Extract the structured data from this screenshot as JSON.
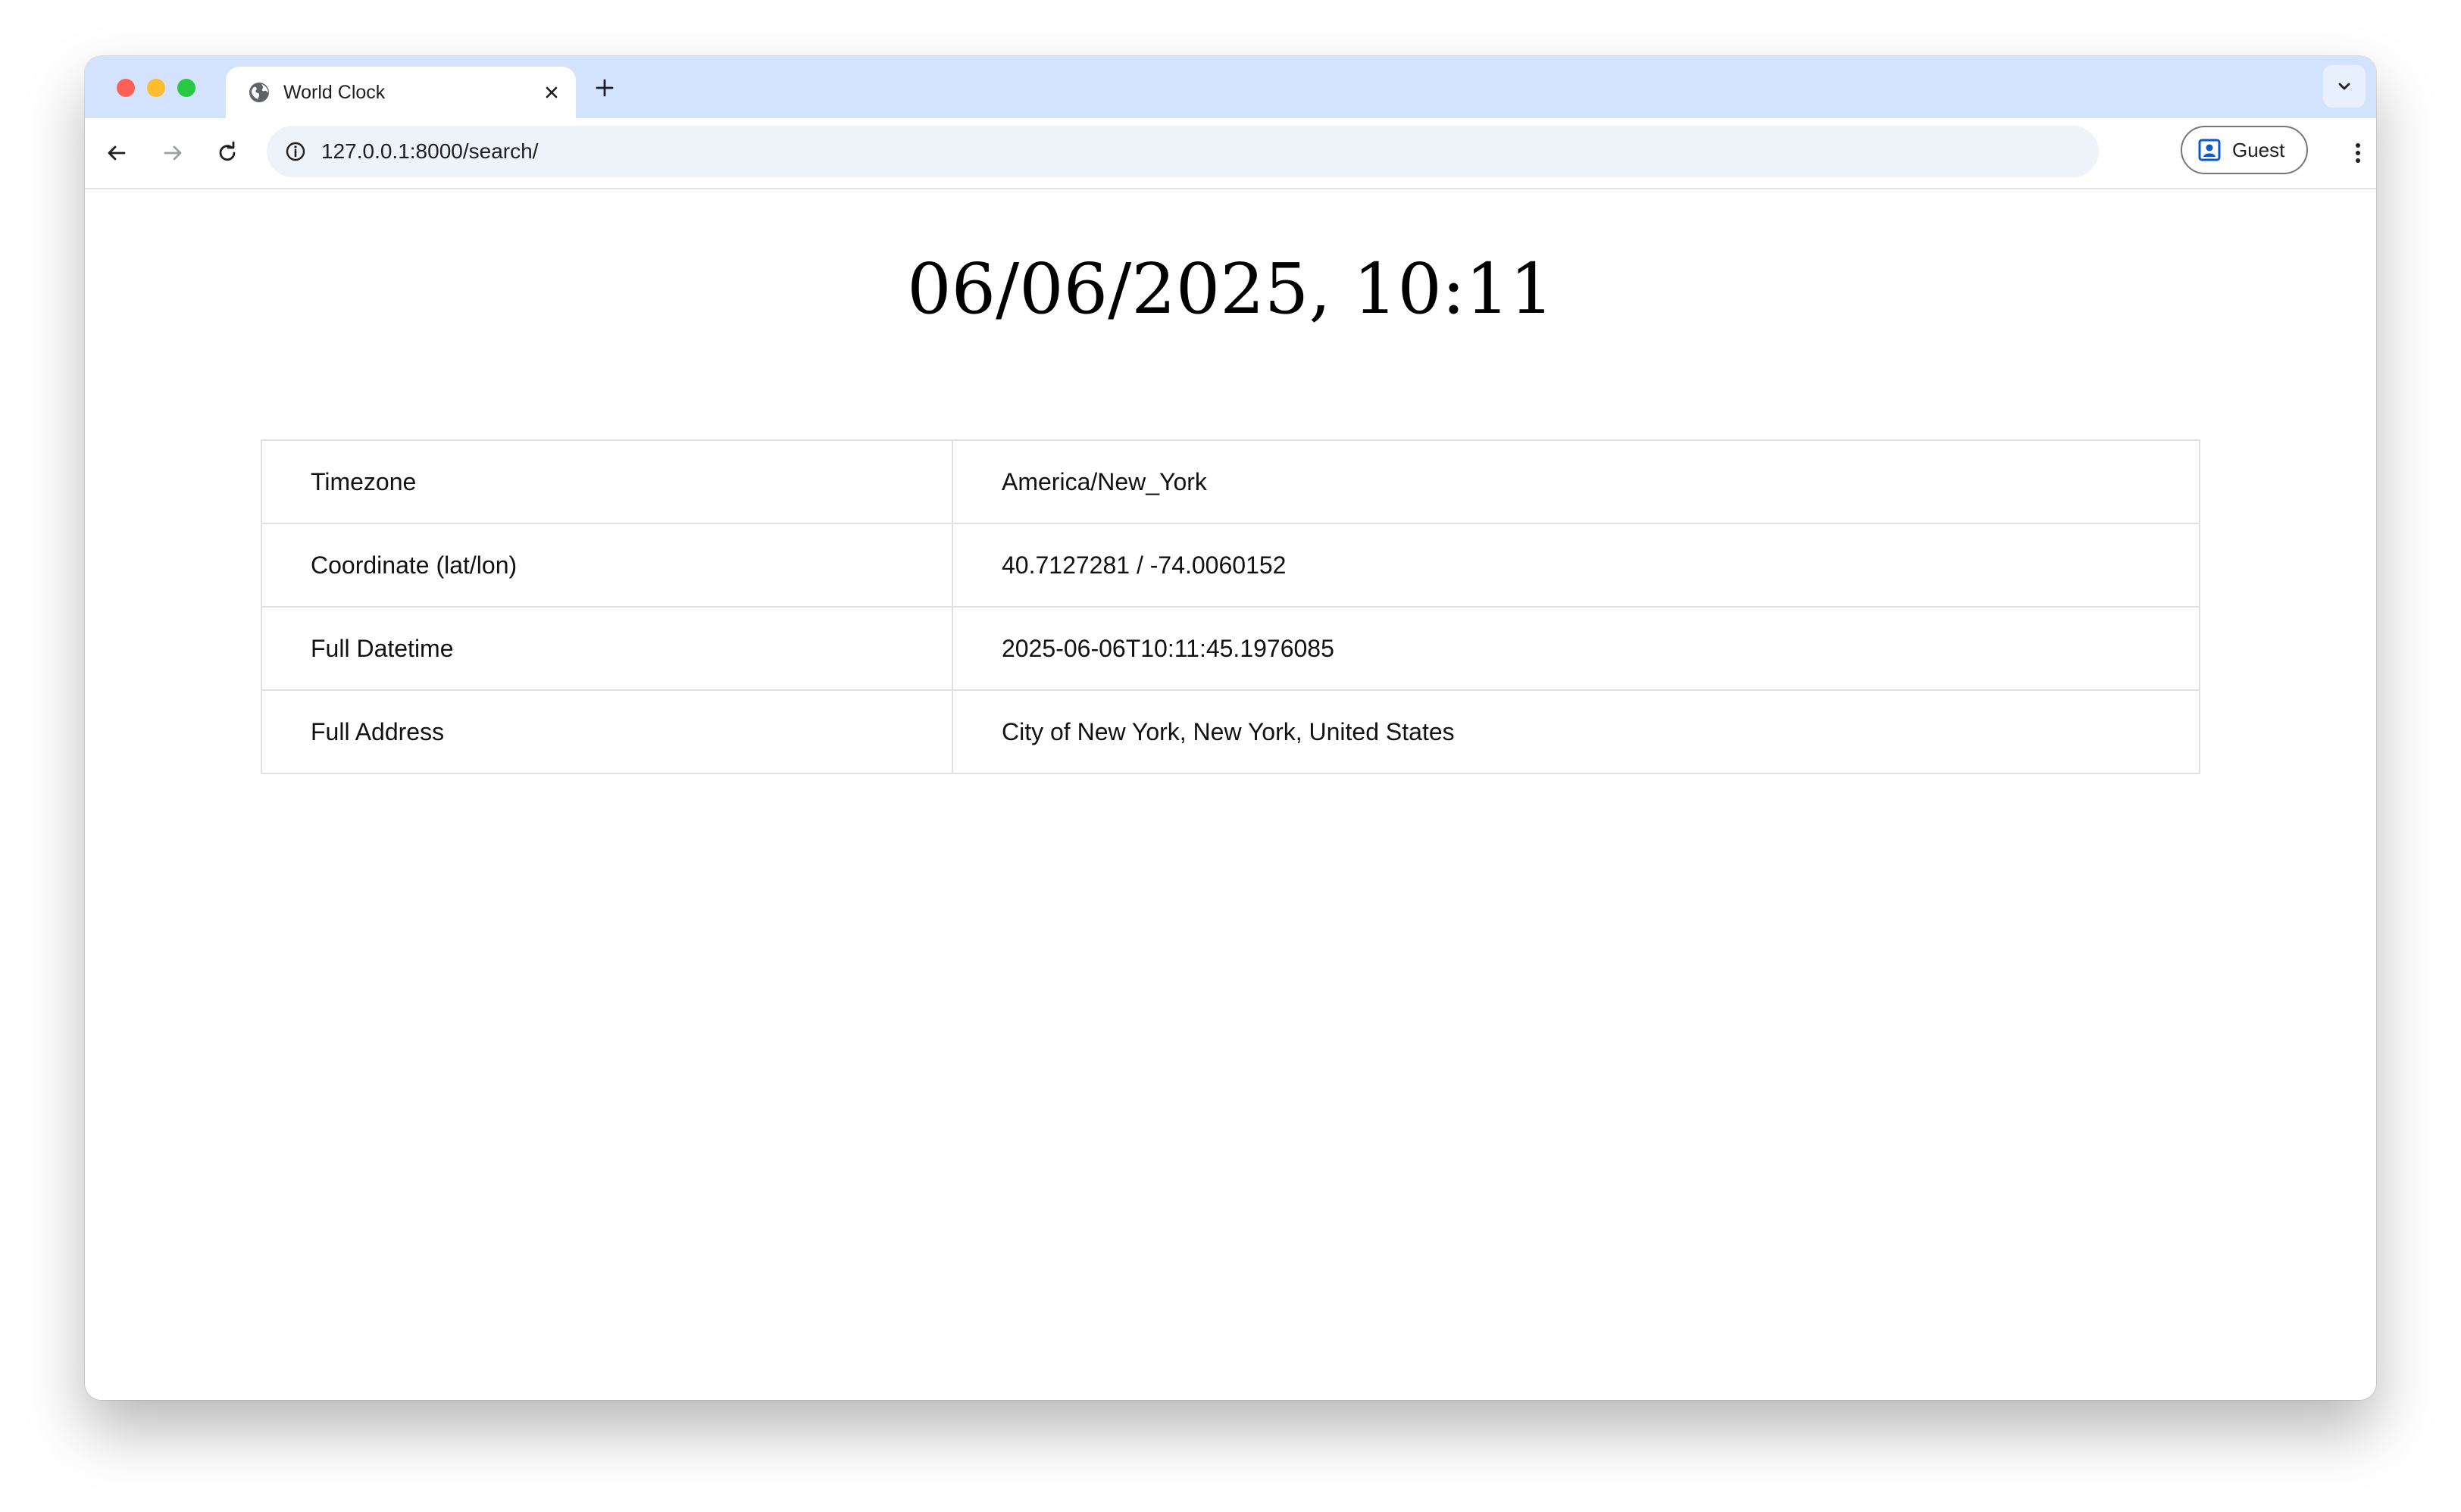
{
  "browser": {
    "tab": {
      "title": "World Clock"
    },
    "address_bar": {
      "url": "127.0.0.1:8000/search/"
    },
    "profile": {
      "label": "Guest"
    }
  },
  "page": {
    "heading": "06/06/2025, 10:11",
    "details": [
      {
        "key": "Timezone",
        "value": "America/New_York"
      },
      {
        "key": "Coordinate (lat/lon)",
        "value": "40.7127281 / -74.0060152"
      },
      {
        "key": "Full Datetime",
        "value": "2025-06-06T10:11:45.1976085"
      },
      {
        "key": "Full Address",
        "value": "City of New York, New York, United States"
      }
    ]
  },
  "colors": {
    "tabstrip": "#d3e3fd",
    "omnibox": "#eef2f9",
    "close": "#ff5f57",
    "minimize": "#febc2e",
    "zoom": "#28c840",
    "profile_icon": "#0b57d0"
  }
}
